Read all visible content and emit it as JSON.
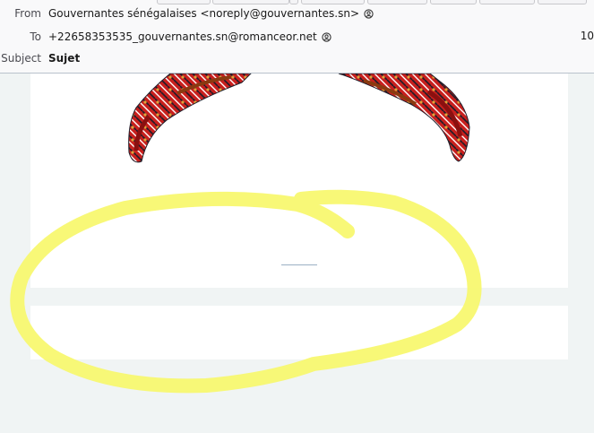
{
  "header": {
    "from": {
      "label": "From",
      "value": "Gouvernantes sénégalaises <noreply@gouvernantes.sn>"
    },
    "to": {
      "label": "To",
      "value": "+22658353535_gouvernantes.sn@romanceor.net",
      "date_fragment": "10"
    },
    "subject": {
      "label": "Subject",
      "value": "Sujet"
    }
  },
  "body": {
    "image": "african-wax-print-headwrap-graphic",
    "annotation": "yellow-highlighter-circle"
  },
  "colors": {
    "highlighter": "#f7f76b",
    "print_red": "#c8201e",
    "print_dark": "#1e1e2a"
  }
}
